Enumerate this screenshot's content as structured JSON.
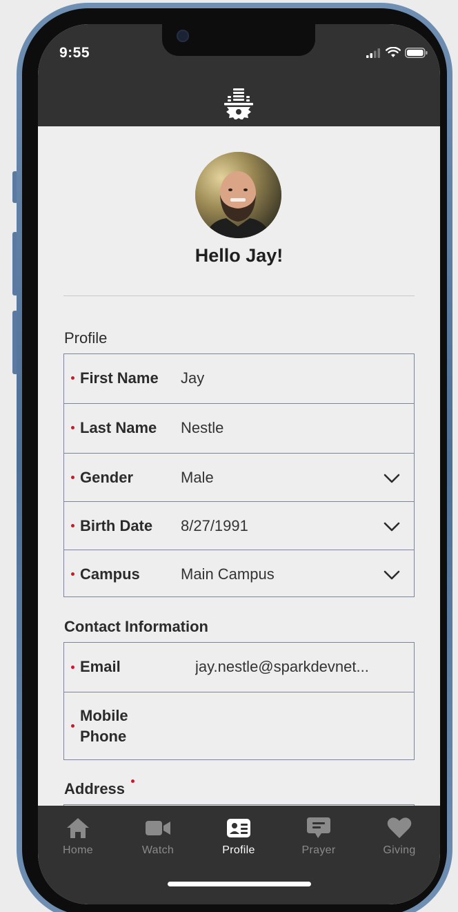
{
  "status_bar": {
    "time": "9:55"
  },
  "profile": {
    "greeting": "Hello Jay!",
    "section_title": "Profile",
    "fields": [
      {
        "label": "First Name",
        "value": "Jay",
        "required": true,
        "dropdown": false
      },
      {
        "label": "Last Name",
        "value": "Nestle",
        "required": true,
        "dropdown": false
      },
      {
        "label": "Gender",
        "value": "Male",
        "required": true,
        "dropdown": true
      },
      {
        "label": "Birth Date",
        "value": "8/27/1991",
        "required": true,
        "dropdown": true
      },
      {
        "label": "Campus",
        "value": "Main Campus",
        "required": true,
        "dropdown": true
      }
    ]
  },
  "contact": {
    "section_title": "Contact Information",
    "email_label": "Email",
    "email_value": "jay.nestle@sparkdevnet...",
    "mobile_label_line1": "Mobile",
    "mobile_label_line2": "Phone",
    "mobile_value": ""
  },
  "address": {
    "section_title": "Address"
  },
  "tabbar": {
    "tabs": [
      {
        "label": "Home",
        "icon": "home-icon",
        "active": false
      },
      {
        "label": "Watch",
        "icon": "video-camera-icon",
        "active": false
      },
      {
        "label": "Profile",
        "icon": "id-card-icon",
        "active": true
      },
      {
        "label": "Prayer",
        "icon": "speech-bubble-icon",
        "active": false
      },
      {
        "label": "Giving",
        "icon": "heart-icon",
        "active": false
      }
    ]
  },
  "colors": {
    "header_bg": "#323232",
    "screen_bg": "#eeeeee",
    "required_dot": "#d4142c",
    "tab_active": "#ffffff",
    "tab_inactive": "#8a8a8a",
    "border": "#7c8592"
  }
}
